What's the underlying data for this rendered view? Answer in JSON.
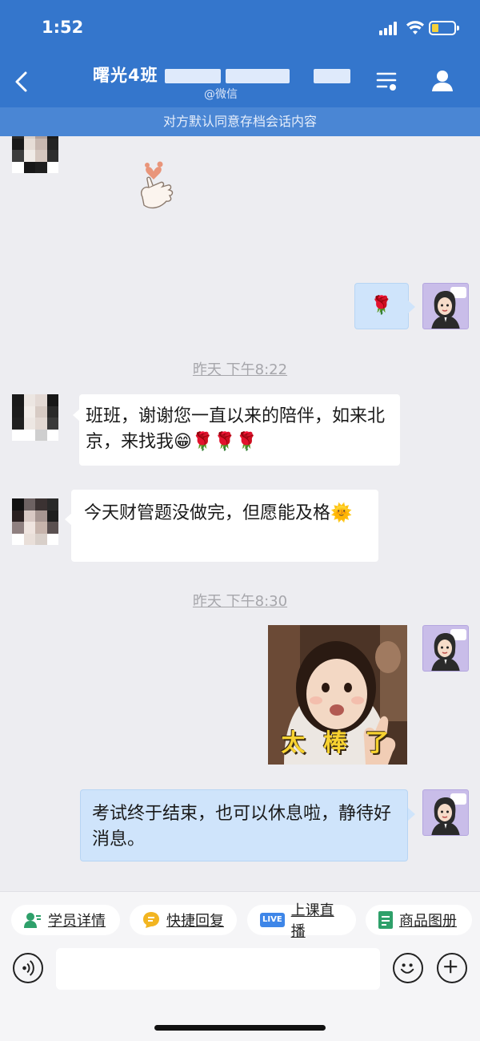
{
  "status_bar": {
    "time": "1:52"
  },
  "header": {
    "title": "曙光4班",
    "subtitle": "@微信",
    "back_icon": "chevron-left-icon",
    "list_icon": "list-settings-icon",
    "user_icon": "user-icon",
    "color": "#3476cc"
  },
  "notice": "对方默认同意存档会话内容",
  "messages": [
    {
      "side": "in",
      "type": "sticker",
      "icon": "finger-heart-icon"
    },
    {
      "side": "out",
      "type": "emoji",
      "content": "🌹"
    },
    {
      "type": "time",
      "text": "昨天 下午8:22"
    },
    {
      "side": "in",
      "type": "text",
      "text": "班班，谢谢您一直以来的陪伴，如来北京，来找我😁🌹🌹🌹"
    },
    {
      "side": "in",
      "type": "text",
      "text": "今天财管题没做完，但愿能及格🌞"
    },
    {
      "type": "time",
      "text": "昨天 下午8:30"
    },
    {
      "side": "out",
      "type": "sticker",
      "caption": "太 棒 了"
    },
    {
      "side": "out",
      "type": "text",
      "text": "考试终于结束，也可以休息啦，静待好消息。"
    }
  ],
  "quick_actions": [
    {
      "label": "学员详情",
      "icon": "student-info-icon",
      "color": "#2ea06a"
    },
    {
      "label": "快捷回复",
      "icon": "quick-reply-icon",
      "color": "#f2b521"
    },
    {
      "label": "上课直播",
      "icon": "live-icon",
      "badge": "LIVE",
      "color": "#3e86e8"
    },
    {
      "label": "商品图册",
      "icon": "catalog-icon",
      "color": "#2ea06a"
    }
  ],
  "input": {
    "placeholder": ""
  },
  "colors": {
    "bubble_out": "#cfe4fb",
    "bubble_in": "#ffffff",
    "background": "#ededf1"
  }
}
